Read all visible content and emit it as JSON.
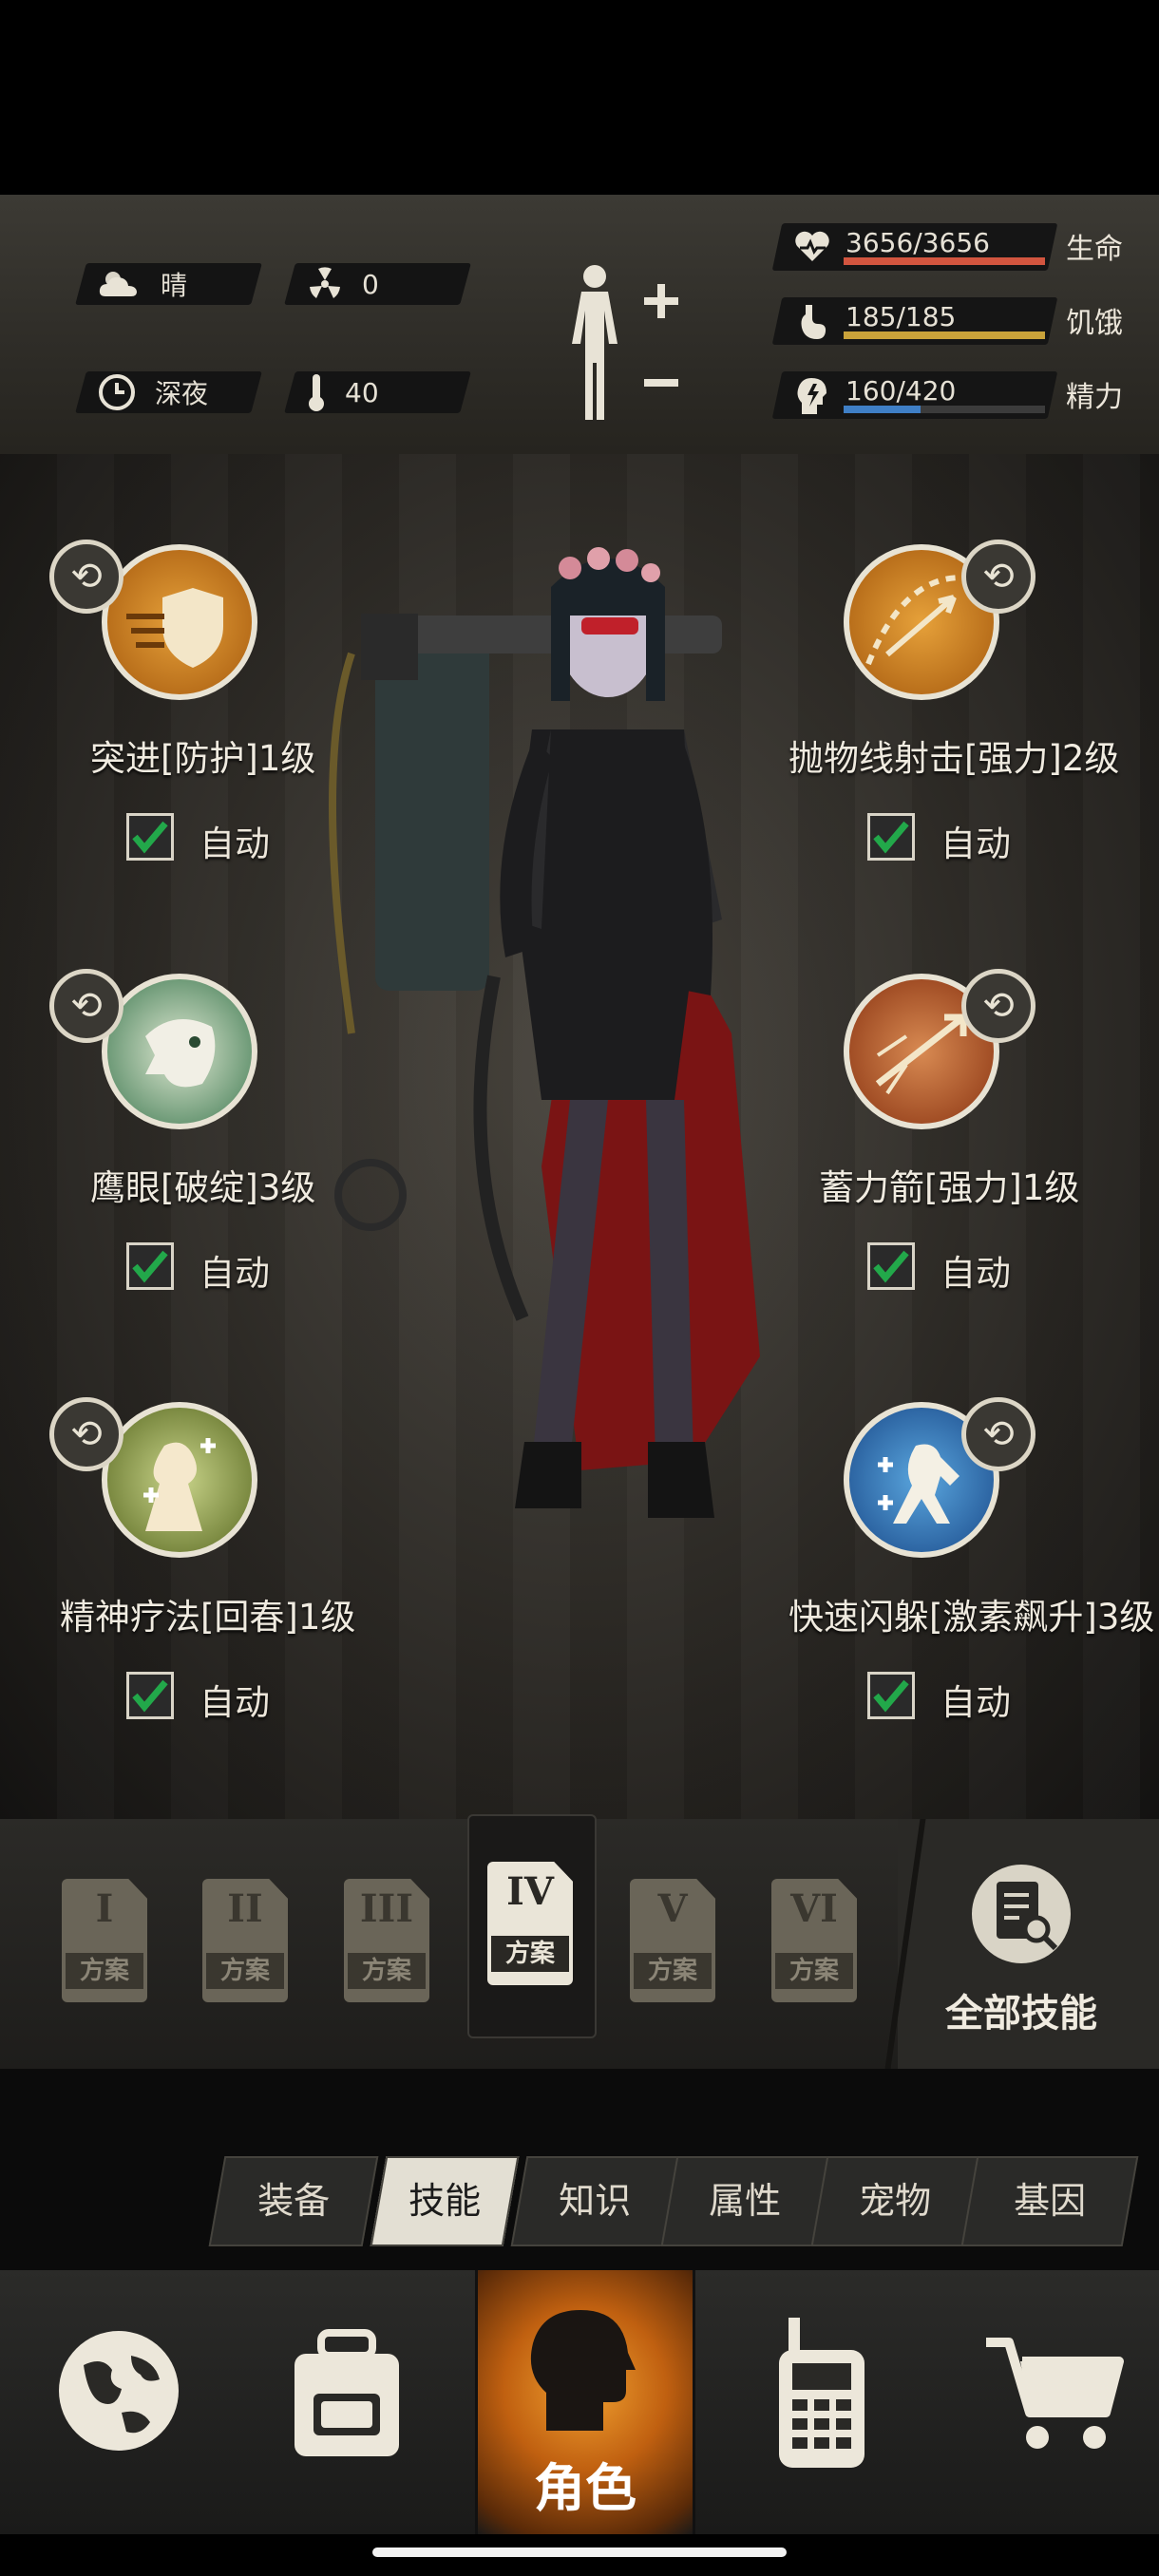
{
  "hud": {
    "weather": "晴",
    "radiation": "0",
    "time_of_day": "深夜",
    "temperature": "40",
    "stats": [
      {
        "value": "3656/3656",
        "label": "生命",
        "fill": 1.0,
        "color": "#d2553f"
      },
      {
        "value": "185/185",
        "label": "饥饿",
        "fill": 1.0,
        "color": "#c9a23a"
      },
      {
        "value": "160/420",
        "label": "精力",
        "fill": 0.38,
        "color": "#3f7fc6"
      }
    ]
  },
  "skills": [
    {
      "name": "突进[防护]1级",
      "auto": "自动",
      "icon": "charge-shield-icon"
    },
    {
      "name": "抛物线射击[强力]2级",
      "auto": "自动",
      "icon": "parabolic-shot-icon"
    },
    {
      "name": "鹰眼[破绽]3级",
      "auto": "自动",
      "icon": "eagle-eye-icon"
    },
    {
      "name": "蓄力箭[强力]1级",
      "auto": "自动",
      "icon": "charged-arrow-icon"
    },
    {
      "name": "精神疗法[回春]1级",
      "auto": "自动",
      "icon": "mental-therapy-icon"
    },
    {
      "name": "快速闪躲[激素飙升]3级",
      "auto": "自动",
      "icon": "quick-dodge-icon"
    }
  ],
  "plans": [
    {
      "num": "I",
      "label": "方案"
    },
    {
      "num": "II",
      "label": "方案"
    },
    {
      "num": "III",
      "label": "方案"
    },
    {
      "num": "IV",
      "label": "方案"
    },
    {
      "num": "V",
      "label": "方案"
    },
    {
      "num": "VI",
      "label": "方案"
    }
  ],
  "all_skills_label": "全部技能",
  "tabs": [
    "装备",
    "技能",
    "知识",
    "属性",
    "宠物",
    "基因"
  ],
  "active_tab": "技能",
  "nav": {
    "character_label": "角色"
  }
}
